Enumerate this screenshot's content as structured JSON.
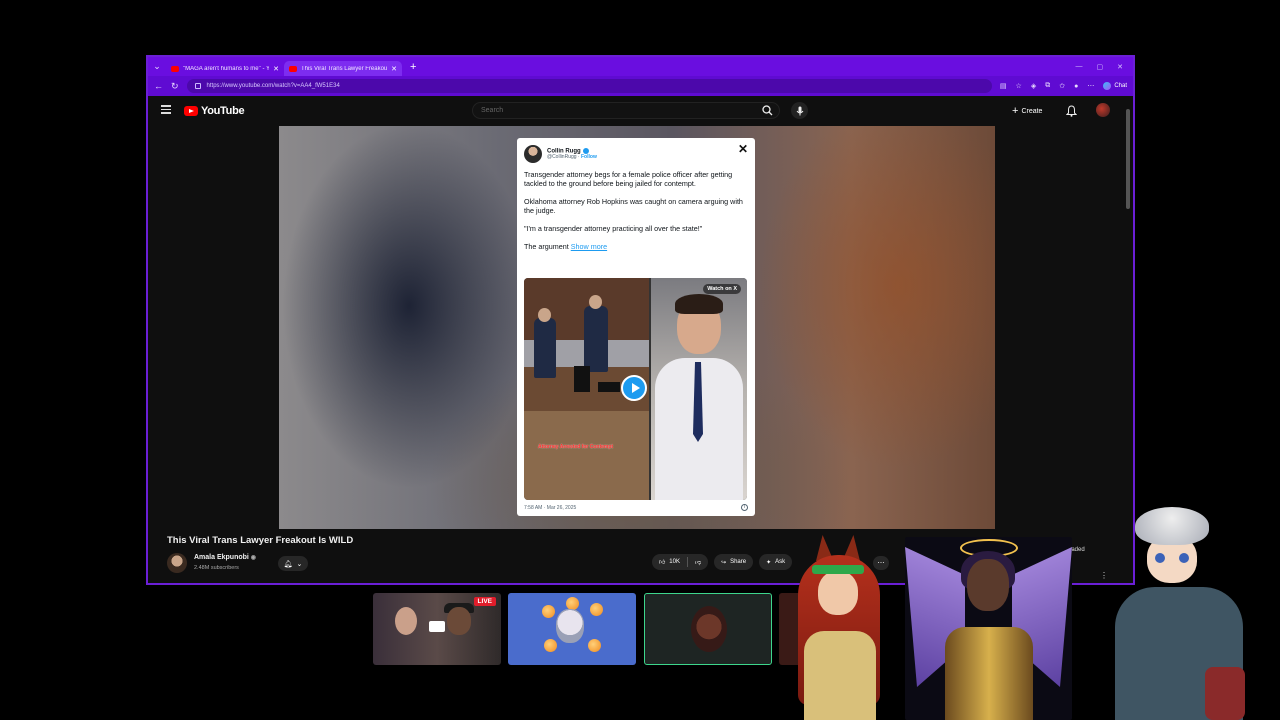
{
  "browser": {
    "tabs": [
      {
        "title": "\"MAGA aren't humans to me\" - Yo",
        "active": false
      },
      {
        "title": "This Viral Trans Lawyer Freakout Is",
        "active": true
      }
    ],
    "url": "https://www.youtube.com/watch?v=AA4_fW51E34",
    "chat_label": "Chat"
  },
  "youtube": {
    "logo_text": "YouTube",
    "search_placeholder": "Search",
    "create_label": "Create"
  },
  "tweet": {
    "author": "Collin Rugg",
    "handle": "@CollinRugg",
    "follow": "Follow",
    "paragraphs": [
      "Transgender attorney begs for a female police officer after getting tackled to the ground before being jailed for contempt.",
      "Oklahoma attorney Rob Hopkins was caught on camera arguing with the judge.",
      "\"I'm a transgender attorney practicing all over the state!\""
    ],
    "last_line": "The argument",
    "show_more": "Show more",
    "watch_on_x": "Watch on X",
    "media_caption": "Attorney Arrested for Contempt",
    "timestamp": "7:58 AM · Mar 26, 2025"
  },
  "video": {
    "title": "This Viral Trans Lawyer Freakout Is WILD",
    "channel": "Amala Ekpunobi",
    "subscribers": "2.48M subscribers",
    "likes": "10K",
    "share_label": "Share",
    "ask_label": "Ask",
    "downloaded_label": "oaded"
  },
  "stream": {
    "live_label": "LIVE"
  },
  "colors": {
    "browser_accent": "#6a0ee0",
    "youtube_red": "#ff0000",
    "live_red": "#e11d2b",
    "twitter_blue": "#1d9bf0",
    "speaking_green": "#3dd68c"
  },
  "icons": [
    "hamburger-icon",
    "search-icon",
    "mic-icon",
    "plus-icon",
    "bell-icon",
    "verified-icon",
    "like-icon",
    "dislike-icon",
    "share-icon",
    "ask-icon",
    "more-icon",
    "close-icon",
    "play-icon",
    "screen-share-icon"
  ]
}
